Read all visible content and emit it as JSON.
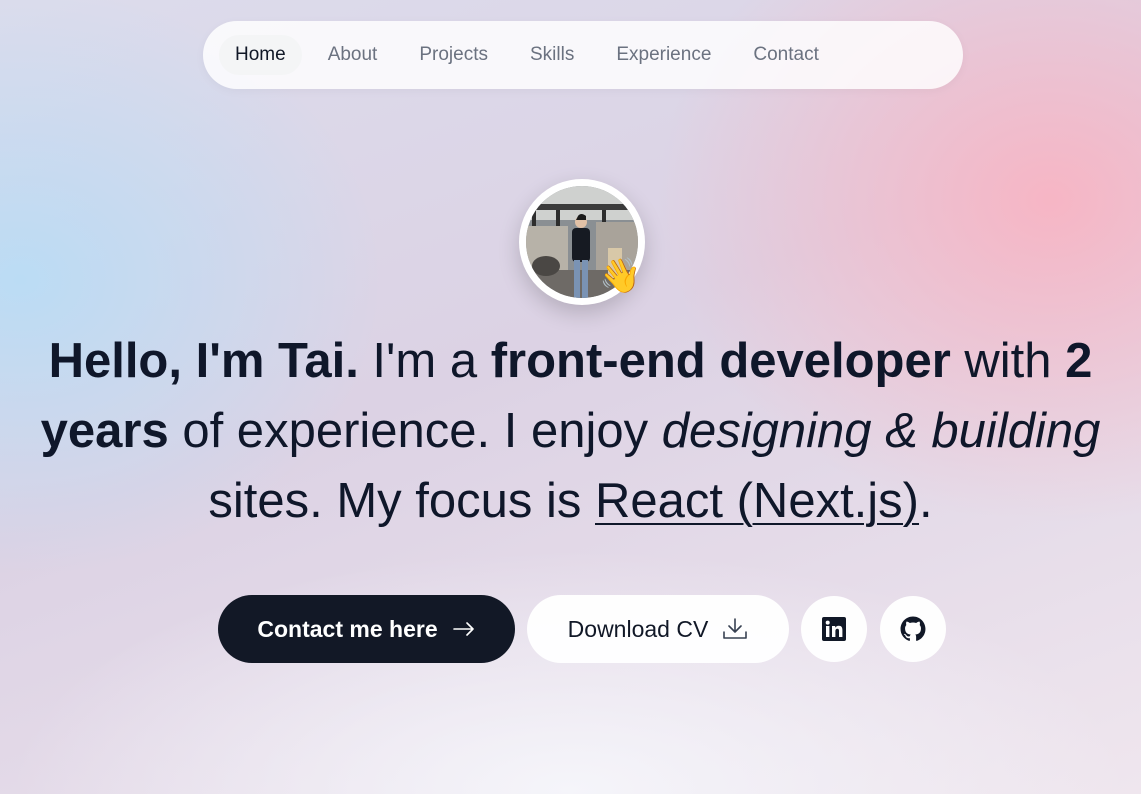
{
  "nav": {
    "items": [
      {
        "label": "Home",
        "active": true
      },
      {
        "label": "About"
      },
      {
        "label": "Projects"
      },
      {
        "label": "Skills"
      },
      {
        "label": "Experience"
      },
      {
        "label": "Contact"
      }
    ]
  },
  "hero": {
    "wave_emoji": "👋",
    "headline": {
      "greeting": "Hello, I'm Tai.",
      "t1": " I'm a ",
      "role": "front-end developer",
      "t2": " with ",
      "years": "2 years",
      "t3": " of experience. I enjoy ",
      "italic": "designing & building",
      "t4": " sites. My focus is ",
      "focus": "React (Next.js)",
      "t5": "."
    }
  },
  "actions": {
    "contact_label": "Contact me here",
    "cv_label": "Download CV",
    "linkedin_icon": "linkedin-icon",
    "github_icon": "github-icon"
  },
  "colors": {
    "primary_button": "#121826",
    "text": "#0f172a",
    "nav_inactive": "#6b7280"
  }
}
